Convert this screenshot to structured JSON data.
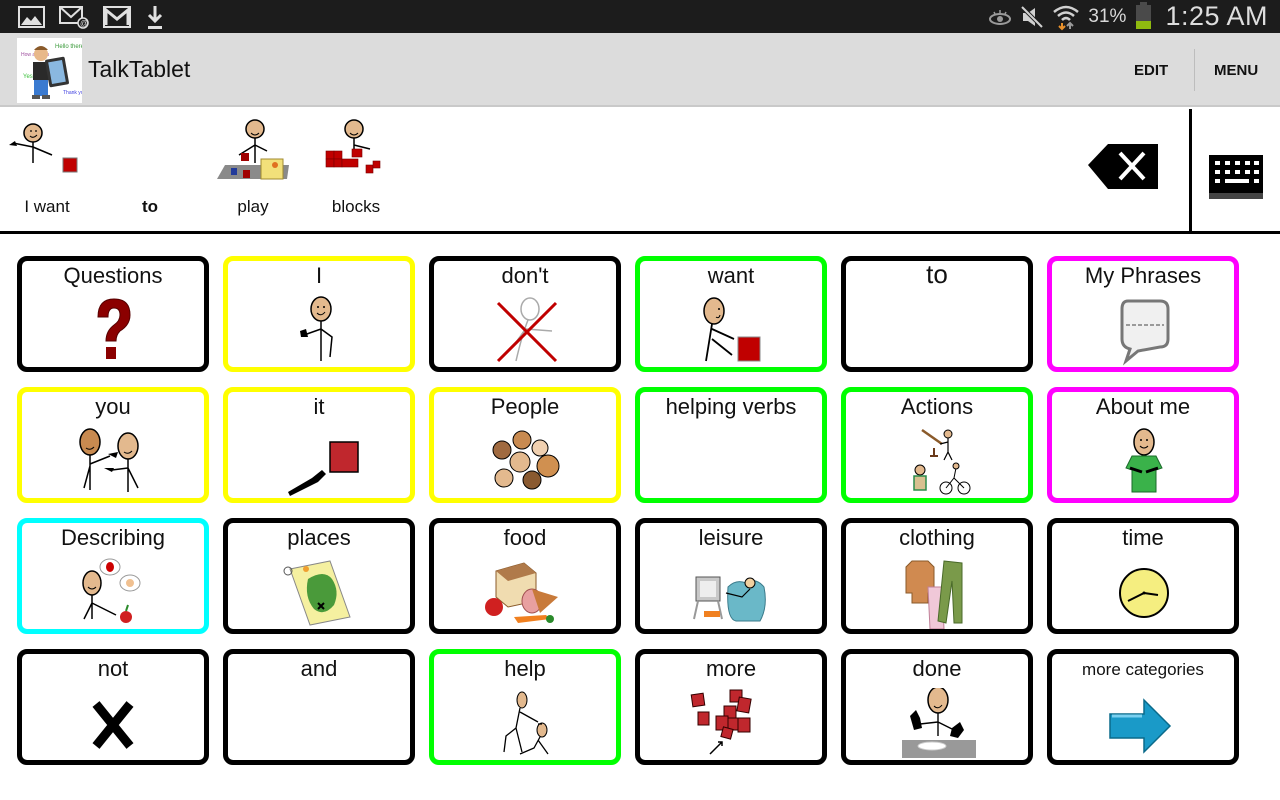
{
  "status_bar": {
    "left_icons": [
      "gallery-icon",
      "email-icon",
      "gmail-icon",
      "download-icon"
    ],
    "right_icons": [
      "eye-icon",
      "mute-icon",
      "wifi-icon"
    ],
    "battery_percent_label": "31%",
    "battery_level": 0.31,
    "time": "1:25 AM"
  },
  "action_bar": {
    "app_title": "TalkTablet",
    "edit_label": "EDIT",
    "menu_label": "MENU"
  },
  "sentence_strip": {
    "words": [
      {
        "label": "I want",
        "icon": "i-want-symbol",
        "bold": false
      },
      {
        "label": "to",
        "icon": "",
        "bold": true
      },
      {
        "label": "play",
        "icon": "play-symbol",
        "bold": false
      },
      {
        "label": "blocks",
        "icon": "blocks-symbol",
        "bold": false
      }
    ],
    "backspace_icon": "backspace-icon",
    "keyboard_icon": "keyboard-icon"
  },
  "colors": {
    "pronoun": "#ffff00",
    "verb": "#00ff00",
    "social": "#ff00ff",
    "describing": "#00ffff",
    "default": "#000000"
  },
  "grid": {
    "rows": [
      [
        {
          "label": "Questions",
          "icon": "question-mark-symbol",
          "border": "#000000"
        },
        {
          "label": "I",
          "icon": "i-symbol",
          "border": "#ffff00"
        },
        {
          "label": "don't",
          "icon": "dont-symbol",
          "border": "#000000"
        },
        {
          "label": "want",
          "icon": "want-symbol",
          "border": "#00ff00"
        },
        {
          "label": "to",
          "icon": "",
          "border": "#000000"
        },
        {
          "label": "My Phrases",
          "icon": "speech-bubble-symbol",
          "border": "#ff00ff"
        }
      ],
      [
        {
          "label": "you",
          "icon": "you-symbol",
          "border": "#ffff00"
        },
        {
          "label": "it",
          "icon": "it-symbol",
          "border": "#ffff00"
        },
        {
          "label": "People",
          "icon": "people-symbol",
          "border": "#ffff00"
        },
        {
          "label": "helping verbs",
          "icon": "",
          "border": "#00ff00"
        },
        {
          "label": "Actions",
          "icon": "actions-symbol",
          "border": "#00ff00"
        },
        {
          "label": "About me",
          "icon": "about-me-symbol",
          "border": "#ff00ff"
        }
      ],
      [
        {
          "label": "Describing",
          "icon": "describing-symbol",
          "border": "#00ffff"
        },
        {
          "label": "places",
          "icon": "map-symbol",
          "border": "#000000"
        },
        {
          "label": "food",
          "icon": "food-symbol",
          "border": "#000000"
        },
        {
          "label": "leisure",
          "icon": "leisure-symbol",
          "border": "#000000"
        },
        {
          "label": "clothing",
          "icon": "clothing-symbol",
          "border": "#000000"
        },
        {
          "label": "time",
          "icon": "clock-symbol",
          "border": "#000000"
        }
      ],
      [
        {
          "label": "not",
          "icon": "x-symbol",
          "border": "#000000"
        },
        {
          "label": "and",
          "icon": "",
          "border": "#000000"
        },
        {
          "label": "help",
          "icon": "help-symbol",
          "border": "#00ff00"
        },
        {
          "label": "more",
          "icon": "more-symbol",
          "border": "#000000"
        },
        {
          "label": "done",
          "icon": "done-symbol",
          "border": "#000000"
        },
        {
          "label": "more categories",
          "icon": "arrow-right-symbol",
          "border": "#000000"
        }
      ]
    ]
  }
}
